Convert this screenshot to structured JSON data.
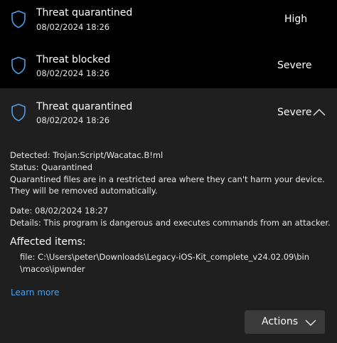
{
  "threats": [
    {
      "title": "Threat quarantined",
      "time": "08/02/2024 18:26",
      "severity": "High",
      "icon": "shield-icon"
    },
    {
      "title": "Threat blocked",
      "time": "08/02/2024 18:26",
      "severity": "Severe",
      "icon": "shield-icon"
    }
  ],
  "expanded": {
    "title": "Threat quarantined",
    "time": "08/02/2024 18:26",
    "severity": "Severe",
    "collapse_icon": "chevron-up-icon",
    "detected": "Detected:  Trojan:Script/Wacatac.B!ml",
    "status": "Status:  Quarantined",
    "status_desc": "Quarantined files are in a restricted area where they can't harm your device. They will be removed automatically.",
    "date": "Date:  08/02/2024 18:27",
    "details": "Details:  This program is dangerous and executes commands from an attacker.",
    "affected_heading": "Affected items:",
    "file_line1": "file: C:\\Users\\peter\\Downloads\\Legacy-iOS-Kit_complete_v24.02.09\\bin",
    "file_line2": "\\macos\\ipwnder",
    "learn_more": "Learn more",
    "actions_label": "Actions",
    "actions_icon": "chevron-down-icon"
  },
  "colors": {
    "shield_stroke": "#4f9fe8",
    "link": "#4aa0e6",
    "expanded_bg": "#1f1f1f",
    "button_bg": "#3a3a3a"
  }
}
